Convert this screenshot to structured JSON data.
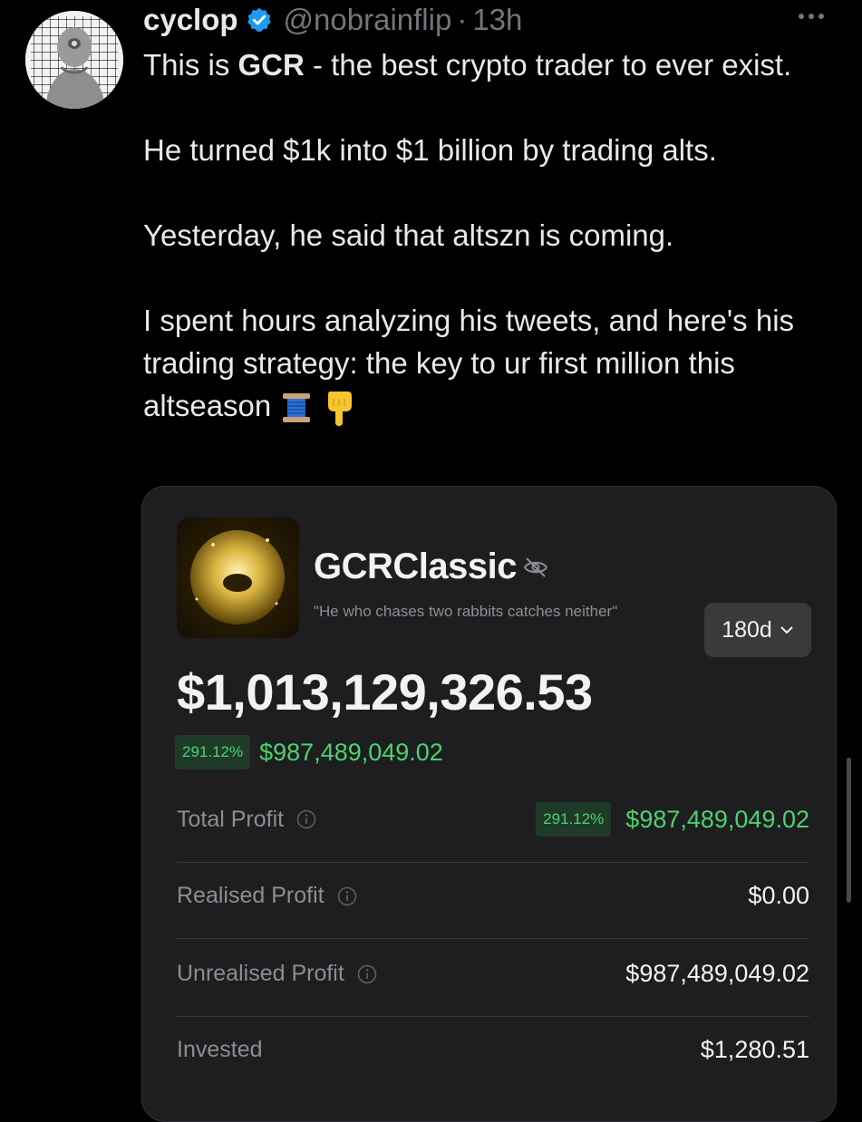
{
  "tweet": {
    "author_name": "cyclop",
    "handle": "@nobrainflip",
    "separator": "·",
    "time": "13h",
    "line1_pre": "This is ",
    "line1_bold": "GCR",
    "line1_post": " - the best crypto trader to ever exist.",
    "para2": "He turned $1k into $1 billion by trading alts.",
    "para3": "Yesterday, he said that altszn is coming.",
    "para4": "I spent hours analyzing his tweets, and here's his trading strategy: the key to ur first million this altseason",
    "emoji1": "thread-spool-emoji",
    "emoji2": "pointing-down-hand-emoji"
  },
  "card": {
    "account_name": "GCRClassic",
    "motto": "\"He who chases two rabbits catches neither\"",
    "period": "180d",
    "balance": "$1,013,129,326.53",
    "gain_pct": "291.12%",
    "gain_value": "$987,489,049.02",
    "rows": [
      {
        "label": "Total Profit",
        "pct": "291.12%",
        "value": "$987,489,049.02",
        "color": "#4bd36f"
      },
      {
        "label": "Realised Profit",
        "value": "$0.00",
        "color": "#f2f2f2"
      },
      {
        "label": "Unrealised Profit",
        "value": "$987,489,049.02",
        "color": "#4bd36f"
      },
      {
        "label": "Invested",
        "value": "$1,280.51",
        "color": "#f2f2f2"
      }
    ]
  },
  "colors": {
    "background": "#000000",
    "text": "#e7e9ea",
    "muted": "#71767b",
    "verified": "#1d9bf0",
    "profit_green": "#4bd36f",
    "card_bg": "#1e1e20"
  }
}
